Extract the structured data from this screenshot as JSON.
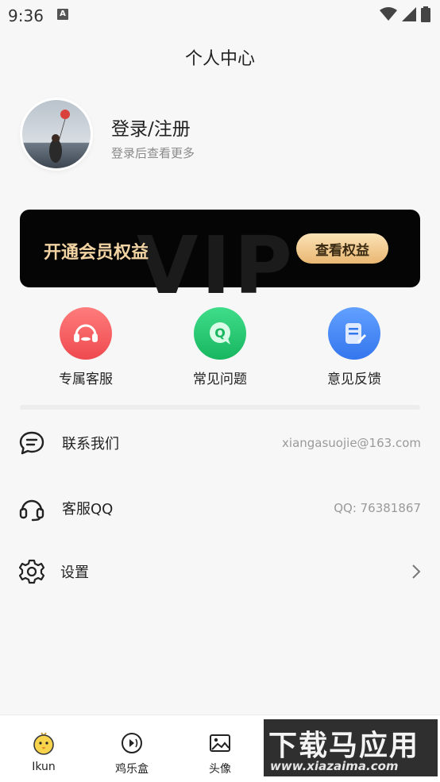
{
  "status_bar": {
    "time": "9:36",
    "notif_icon": "A"
  },
  "header": {
    "title": "个人中心"
  },
  "profile": {
    "title": "登录/注册",
    "subtitle": "登录后查看更多"
  },
  "vip": {
    "title": "开通会员权益",
    "button": "查看权益",
    "watermark": "VIP"
  },
  "quick_actions": [
    {
      "label": "专属客服",
      "icon": "headset-icon",
      "color": "#f25a5c"
    },
    {
      "label": "常见问题",
      "icon": "qa-chat-icon",
      "color": "#23c46b"
    },
    {
      "label": "意见反馈",
      "icon": "feedback-edit-icon",
      "color": "#3f82f5"
    }
  ],
  "list": [
    {
      "label": "联系我们",
      "value": "xiangasuojie@163.com",
      "icon": "chat-bubble-icon"
    },
    {
      "label": "客服QQ",
      "value": "QQ: 76381867",
      "icon": "headphones-icon"
    },
    {
      "label": "设置",
      "value": "",
      "icon": "gear-icon"
    }
  ],
  "bottom_nav": [
    {
      "label": "Ikun",
      "icon": "chick-icon"
    },
    {
      "label": "鸡乐盒",
      "icon": "music-box-icon"
    },
    {
      "label": "头像",
      "icon": "image-icon"
    }
  ],
  "watermark": {
    "main": "下载马应用",
    "sub": "www.xiazaima.com"
  }
}
